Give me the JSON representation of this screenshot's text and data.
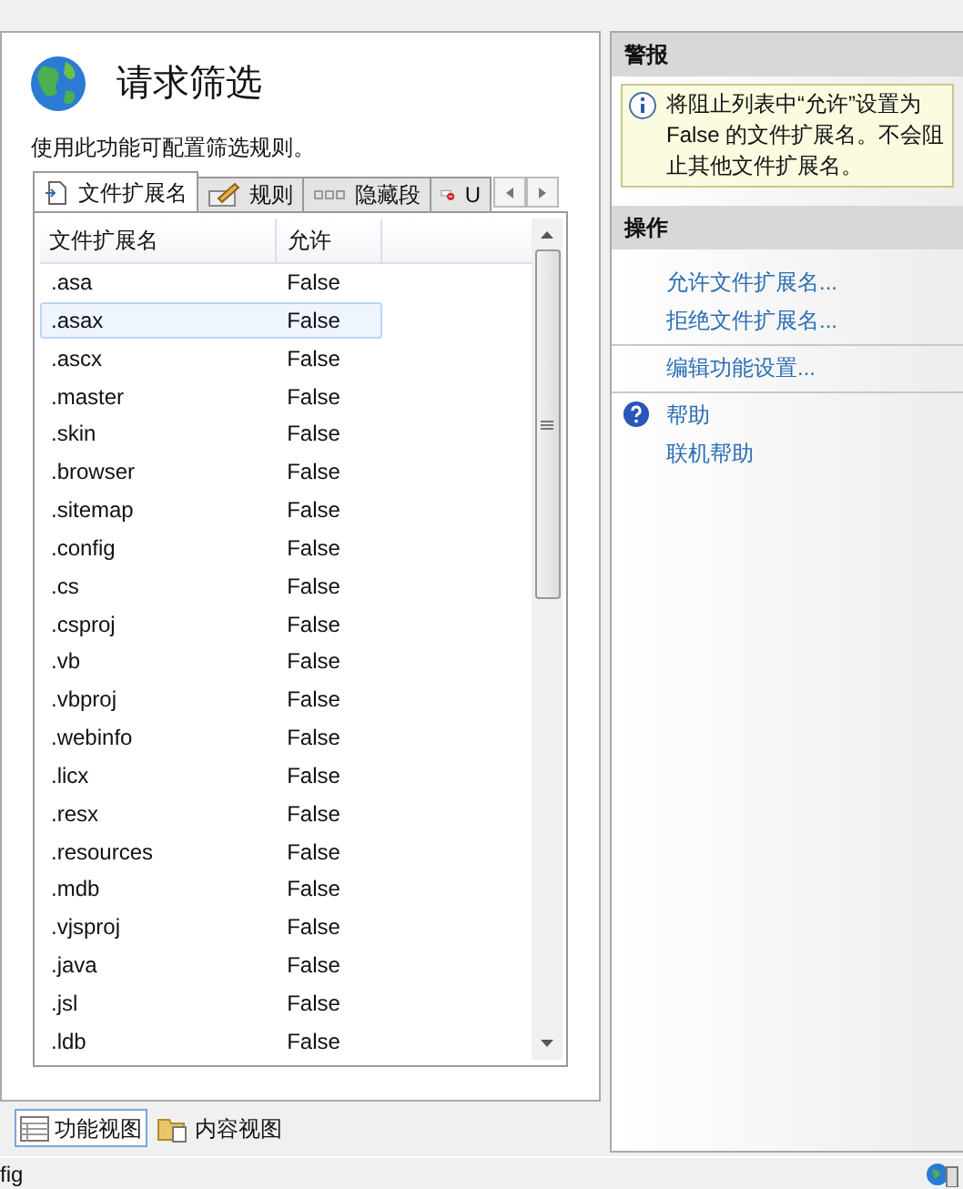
{
  "page": {
    "title": "请求筛选",
    "description": "使用此功能可配置筛选规则。"
  },
  "tabs": [
    {
      "label": "文件扩展名",
      "selected": true,
      "kind": "file"
    },
    {
      "label": "规则",
      "selected": false,
      "kind": "rule"
    },
    {
      "label": "隐藏段",
      "selected": false,
      "kind": "segment"
    },
    {
      "label": "U",
      "selected": false,
      "kind": "block"
    }
  ],
  "table": {
    "columns": [
      "文件扩展名",
      "允许"
    ],
    "rows": [
      {
        "extension": ".asa",
        "allowed": "False",
        "selected": false
      },
      {
        "extension": ".asax",
        "allowed": "False",
        "selected": true
      },
      {
        "extension": ".ascx",
        "allowed": "False",
        "selected": false
      },
      {
        "extension": ".master",
        "allowed": "False",
        "selected": false
      },
      {
        "extension": ".skin",
        "allowed": "False",
        "selected": false
      },
      {
        "extension": ".browser",
        "allowed": "False",
        "selected": false
      },
      {
        "extension": ".sitemap",
        "allowed": "False",
        "selected": false
      },
      {
        "extension": ".config",
        "allowed": "False",
        "selected": false
      },
      {
        "extension": ".cs",
        "allowed": "False",
        "selected": false
      },
      {
        "extension": ".csproj",
        "allowed": "False",
        "selected": false
      },
      {
        "extension": ".vb",
        "allowed": "False",
        "selected": false
      },
      {
        "extension": ".vbproj",
        "allowed": "False",
        "selected": false
      },
      {
        "extension": ".webinfo",
        "allowed": "False",
        "selected": false
      },
      {
        "extension": ".licx",
        "allowed": "False",
        "selected": false
      },
      {
        "extension": ".resx",
        "allowed": "False",
        "selected": false
      },
      {
        "extension": ".resources",
        "allowed": "False",
        "selected": false
      },
      {
        "extension": ".mdb",
        "allowed": "False",
        "selected": false
      },
      {
        "extension": ".vjsproj",
        "allowed": "False",
        "selected": false
      },
      {
        "extension": ".java",
        "allowed": "False",
        "selected": false
      },
      {
        "extension": ".jsl",
        "allowed": "False",
        "selected": false
      },
      {
        "extension": ".ldb",
        "allowed": "False",
        "selected": false
      }
    ]
  },
  "views": [
    {
      "label": "功能视图",
      "selected": true,
      "kind": "feature"
    },
    {
      "label": "内容视图",
      "selected": false,
      "kind": "content"
    }
  ],
  "alerts": {
    "title": "警报",
    "message": "将阻止列表中“允许”设置为 False 的文件扩展名。不会阻止其他文件扩展名。"
  },
  "actions": {
    "title": "操作",
    "groups": [
      {
        "items": [
          {
            "label": "允许文件扩展名..."
          },
          {
            "label": "拒绝文件扩展名..."
          }
        ]
      },
      {
        "items": [
          {
            "label": "编辑功能设置..."
          }
        ]
      },
      {
        "kind": "help",
        "items": [
          {
            "label": "帮助"
          },
          {
            "label": "联机帮助"
          }
        ]
      }
    ]
  },
  "status_bar": {
    "text": "fig"
  }
}
